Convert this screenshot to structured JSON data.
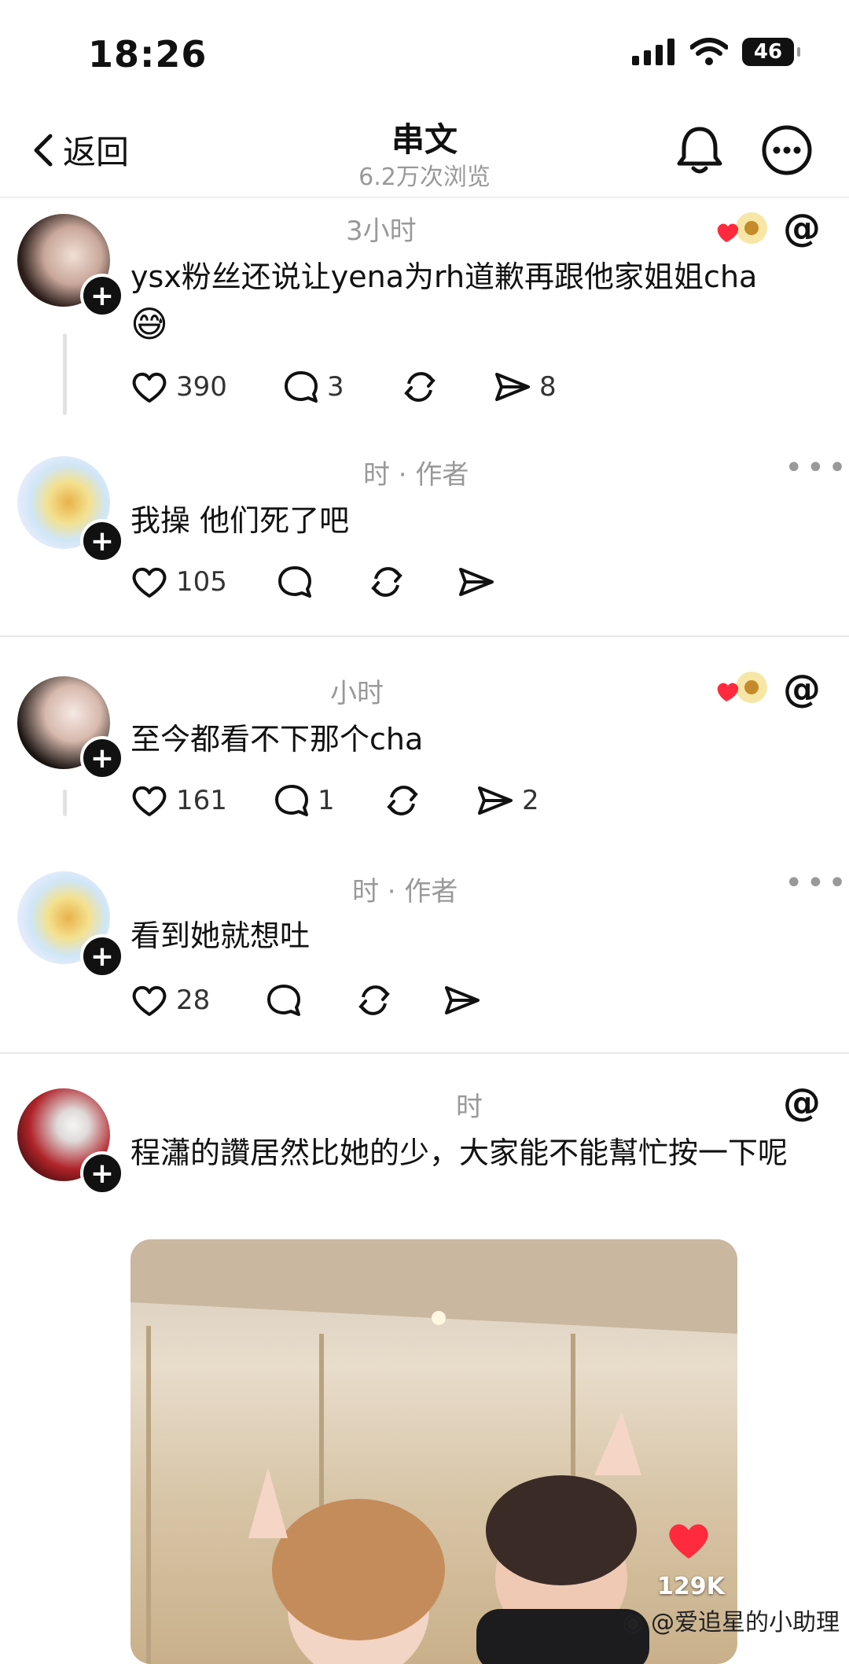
{
  "status": {
    "time": "18:26",
    "battery": "46"
  },
  "header": {
    "back_label": "返回",
    "title": "串文",
    "subtitle": "6.2万次浏览"
  },
  "posts": [
    {
      "time": "3小时",
      "text": "ysx粉丝还说让yena为rh道歉再跟他家姐姐cha",
      "emoji": "😅",
      "likes": "390",
      "comments": "3",
      "shares": "8"
    },
    {
      "time": "时 · 作者",
      "text": "我操 他们死了吧",
      "likes": "105"
    },
    {
      "time": "小时",
      "text": "至今都看不下那个cha",
      "likes": "161",
      "comments": "1",
      "shares": "2"
    },
    {
      "time": "时 · 作者",
      "text": "看到她就想吐",
      "likes": "28"
    },
    {
      "time": "时",
      "text": "程瀟的讚居然比她的少，大家能不能幫忙按一下呢",
      "video_likes": "129K"
    }
  ],
  "watermark": "@爱追星的小助理",
  "icons": [
    "chevron-left-icon",
    "bell-icon",
    "more-icon",
    "heart-icon",
    "comment-icon",
    "repost-icon",
    "send-icon",
    "threads-icon",
    "plus-icon"
  ],
  "colors": {
    "accent_red": "#ff2a3d",
    "text": "#111111",
    "meta": "#999999"
  }
}
